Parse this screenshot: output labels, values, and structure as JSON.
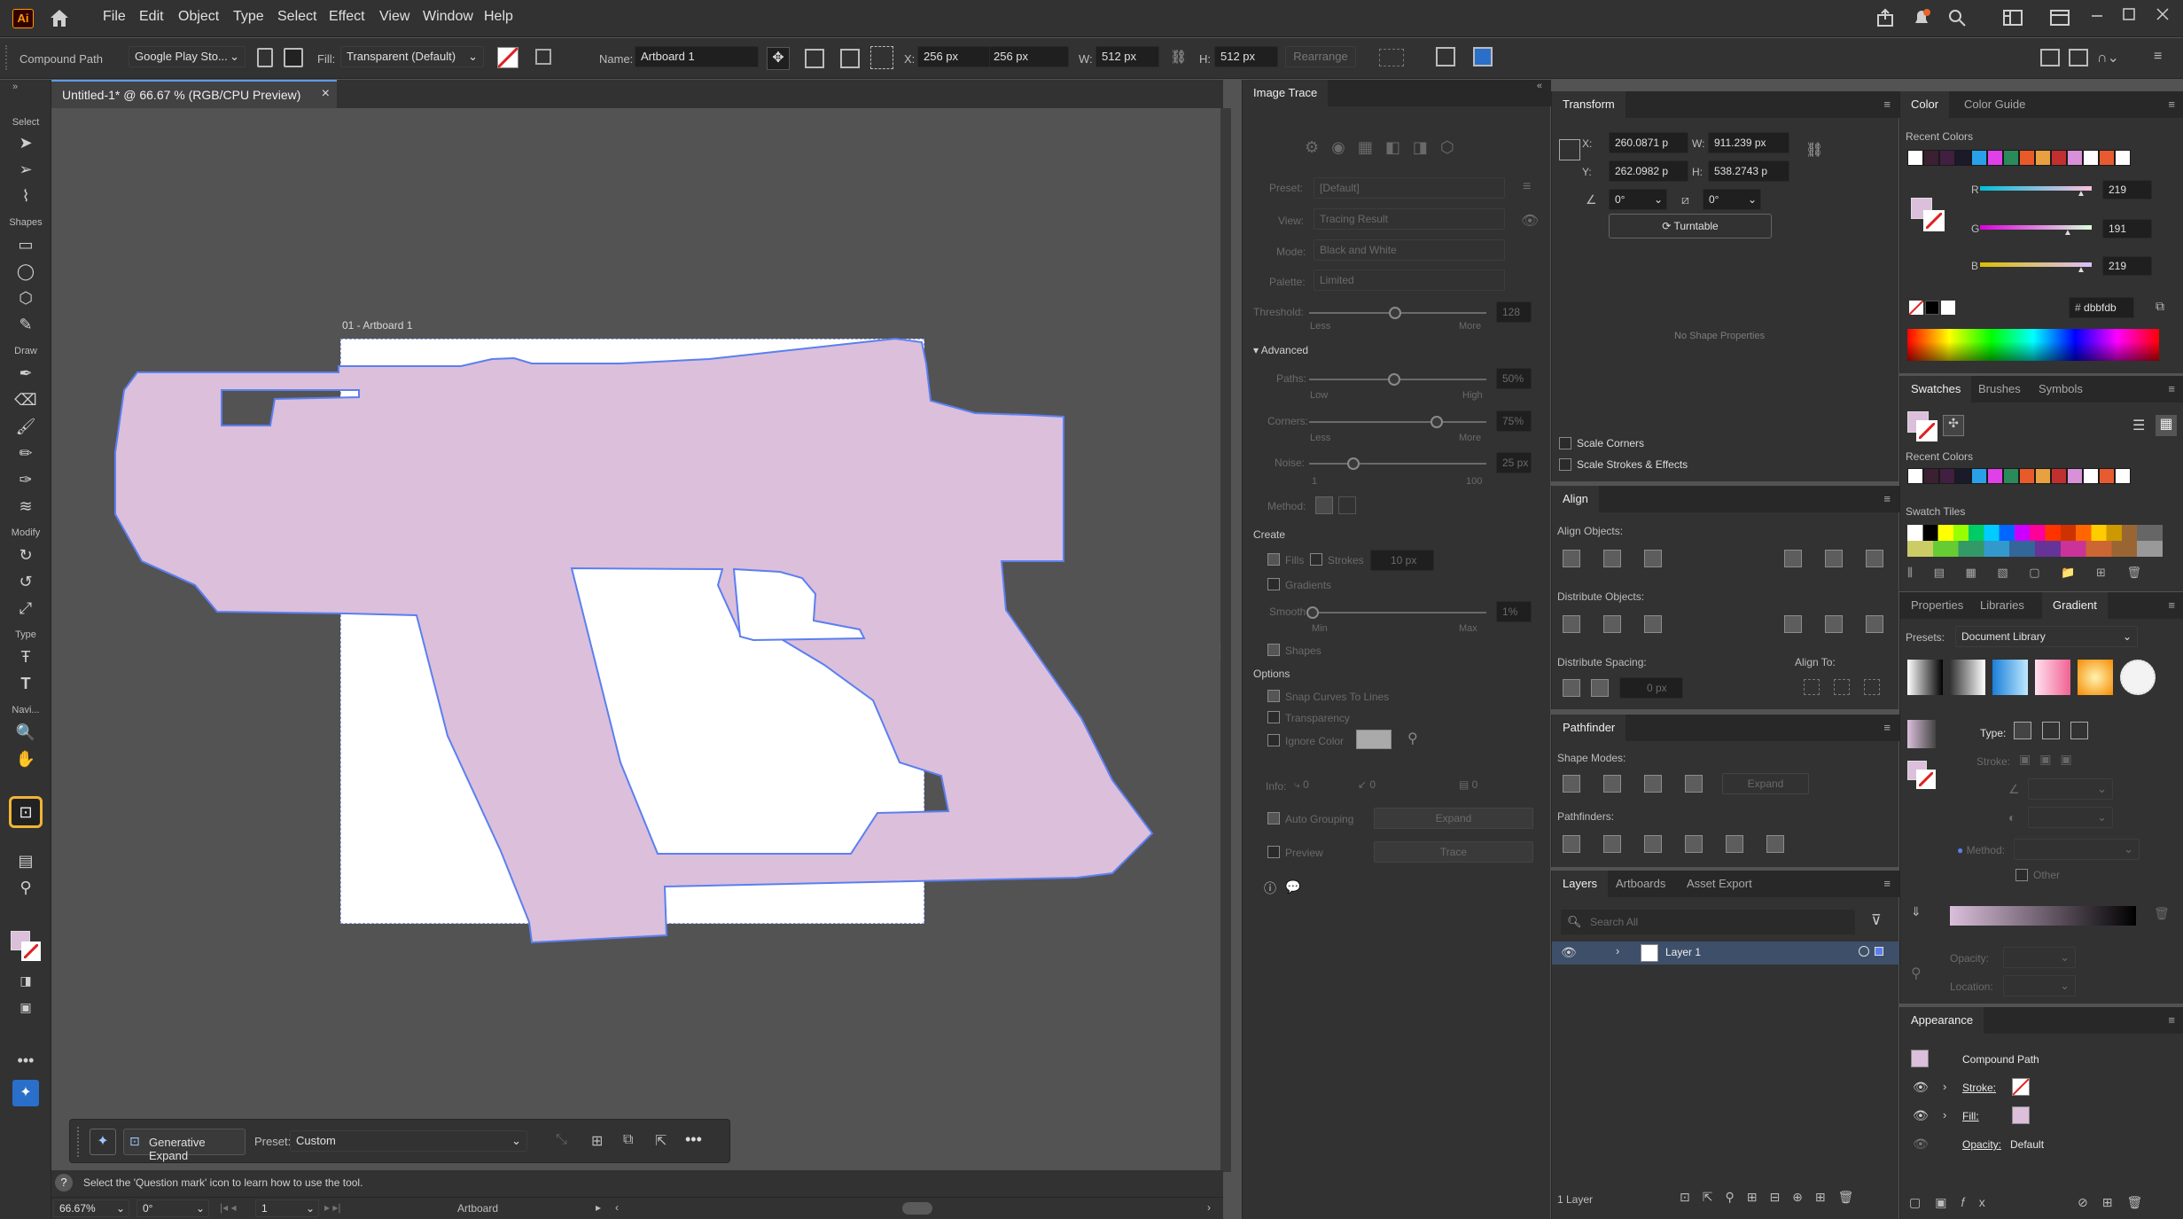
{
  "menubar": {
    "logo": "Ai",
    "items": [
      "File",
      "Edit",
      "Object",
      "Type",
      "Select",
      "Effect",
      "View",
      "Window",
      "Help"
    ]
  },
  "control": {
    "object_type": "Compound Path",
    "font": "Google Play Sto...",
    "fill_label": "Fill:",
    "fill_value": "Transparent (Default)",
    "name_label": "Name:",
    "name_value": "Artboard 1",
    "x_label": "X:",
    "x_value": "256 px",
    "y_label": "Y:",
    "y_value": "256 px",
    "w_label": "W:",
    "w_value": "512 px",
    "h_label": "H:",
    "h_value": "512 px",
    "rearrange": "Rearrange"
  },
  "toolbar": {
    "categories": [
      "Select",
      "Shapes",
      "Draw",
      "Modify",
      "Type",
      "Navi..."
    ]
  },
  "document": {
    "tab_title": "Untitled-1* @ 66.67 % (RGB/CPU Preview)",
    "artboard_label": "01 - Artboard 1",
    "shape_fill": "#dbbfdb",
    "shape_stroke": "#5b7ff0"
  },
  "contextual_bar": {
    "gen_expand": "Generative Expand",
    "preset_label": "Preset:",
    "preset_value": "Custom"
  },
  "status": {
    "hint": "Select the 'Question mark' icon to learn how to use the tool.",
    "zoom": "66.67%",
    "rotation": "0°",
    "artboard_num": "1",
    "mode": "Artboard"
  },
  "image_trace": {
    "title": "Image Trace",
    "preset_label": "Preset:",
    "preset_value": "[Default]",
    "view_label": "View:",
    "view_value": "Tracing Result",
    "mode_label": "Mode:",
    "mode_value": "Black and White",
    "palette_label": "Palette:",
    "palette_value": "Limited",
    "threshold_label": "Threshold:",
    "threshold_value": "128",
    "less": "Less",
    "more": "More",
    "advanced": "Advanced",
    "paths_label": "Paths:",
    "paths_value": "50%",
    "low": "Low",
    "high": "High",
    "corners_label": "Corners:",
    "corners_value": "75%",
    "noise_label": "Noise:",
    "noise_value": "25 px",
    "noise_min": "1",
    "noise_max": "100",
    "method_label": "Method:",
    "create": "Create",
    "fills": "Fills",
    "strokes": "Strokes",
    "stroke_px": "10 px",
    "gradients": "Gradients",
    "smooth_label": "Smooth:",
    "smooth_value": "1%",
    "min": "Min",
    "max": "Max",
    "shapes": "Shapes",
    "options": "Options",
    "snap": "Snap Curves To Lines",
    "transparency": "Transparency",
    "ignore_color": "Ignore Color",
    "info_label": "Info:",
    "info_a": "0",
    "info_b": "0",
    "info_c": "0",
    "auto_grouping": "Auto Grouping",
    "expand": "Expand",
    "preview": "Preview",
    "trace": "Trace"
  },
  "transform": {
    "title": "Transform",
    "x_label": "X:",
    "x_value": "260.0871 p",
    "w_label": "W:",
    "w_value": "911.239 px",
    "y_label": "Y:",
    "y_value": "262.0982 p",
    "h_label": "H:",
    "h_value": "538.2743 p",
    "angle": "0°",
    "shear": "0°",
    "turntable": "Turntable",
    "no_shape": "No Shape Properties",
    "scale_corners": "Scale Corners",
    "scale_strokes": "Scale Strokes & Effects"
  },
  "align": {
    "title": "Align",
    "align_objects": "Align Objects:",
    "distribute_objects": "Distribute Objects:",
    "distribute_spacing": "Distribute Spacing:",
    "align_to": "Align To:",
    "spacing_value": "0 px"
  },
  "pathfinder": {
    "title": "Pathfinder",
    "shape_modes": "Shape Modes:",
    "expand": "Expand",
    "pathfinders": "Pathfinders:"
  },
  "layers": {
    "tabs": [
      "Layers",
      "Artboards",
      "Asset Export"
    ],
    "search_placeholder": "Search All",
    "layer_name": "Layer 1",
    "count": "1 Layer"
  },
  "color": {
    "tabs": [
      "Color",
      "Color Guide"
    ],
    "recent": "Recent Colors",
    "r_label": "R",
    "r_value": "219",
    "g_label": "G",
    "g_value": "191",
    "b_label": "B",
    "b_value": "219",
    "hex": "dbbfdb",
    "recent_swatches": [
      "#ffffff",
      "#3a2030",
      "#401f40",
      "#1a1a2a",
      "#2aa0e8",
      "#e040e8",
      "#2a8a5a",
      "#e85a2a",
      "#e8a040",
      "#c03030",
      "#d890d8",
      "#ffffff",
      "#e85a30",
      "#ffffff"
    ]
  },
  "swatches": {
    "tabs": [
      "Swatches",
      "Brushes",
      "Symbols"
    ],
    "recent": "Recent Colors",
    "tiles": "Swatch Tiles"
  },
  "gradient": {
    "tabs": [
      "Properties",
      "Libraries",
      "Gradient"
    ],
    "presets_label": "Presets:",
    "presets_value": "Document Library",
    "type_label": "Type:",
    "stroke_label": "Stroke:",
    "method_label": "Method:",
    "other": "Other",
    "opacity_label": "Opacity:",
    "location_label": "Location:"
  },
  "appearance": {
    "title": "Appearance",
    "object": "Compound Path",
    "stroke": "Stroke:",
    "fill": "Fill:",
    "opacity": "Opacity:",
    "opacity_value": "Default"
  }
}
